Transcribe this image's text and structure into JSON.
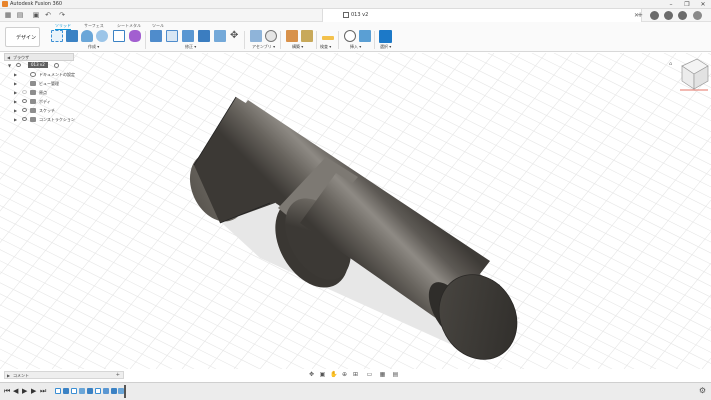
{
  "titlebar": {
    "app_title": "Autodesk Fusion 360",
    "controls": [
      "–",
      "❐",
      "✕"
    ]
  },
  "document_tab": {
    "title": "013 v2",
    "close": "✕"
  },
  "ribbon": {
    "workspace": "デザイン ▾",
    "tabs": [
      "ソリッド",
      "サーフェス",
      "シートメタル",
      "ツール"
    ],
    "groups": [
      "作成 ▾",
      "修正 ▾",
      "アセンブリ ▾",
      "構築 ▾",
      "検査 ▾",
      "挿入 ▾",
      "選択 ▾"
    ]
  },
  "browser": {
    "header": "ブラウザ",
    "root": "013 v2",
    "items": [
      "ドキュメントの設定",
      "ビュー管理",
      "原点",
      "ボディ",
      "スケッチ",
      "コンストラクション"
    ]
  },
  "comments": {
    "label": "コメント"
  },
  "viewcube": {
    "label": "ViewCube"
  },
  "colors": {
    "accent": "#0696d7",
    "brand": "#e8832a",
    "model_body": "#5e5a55"
  }
}
